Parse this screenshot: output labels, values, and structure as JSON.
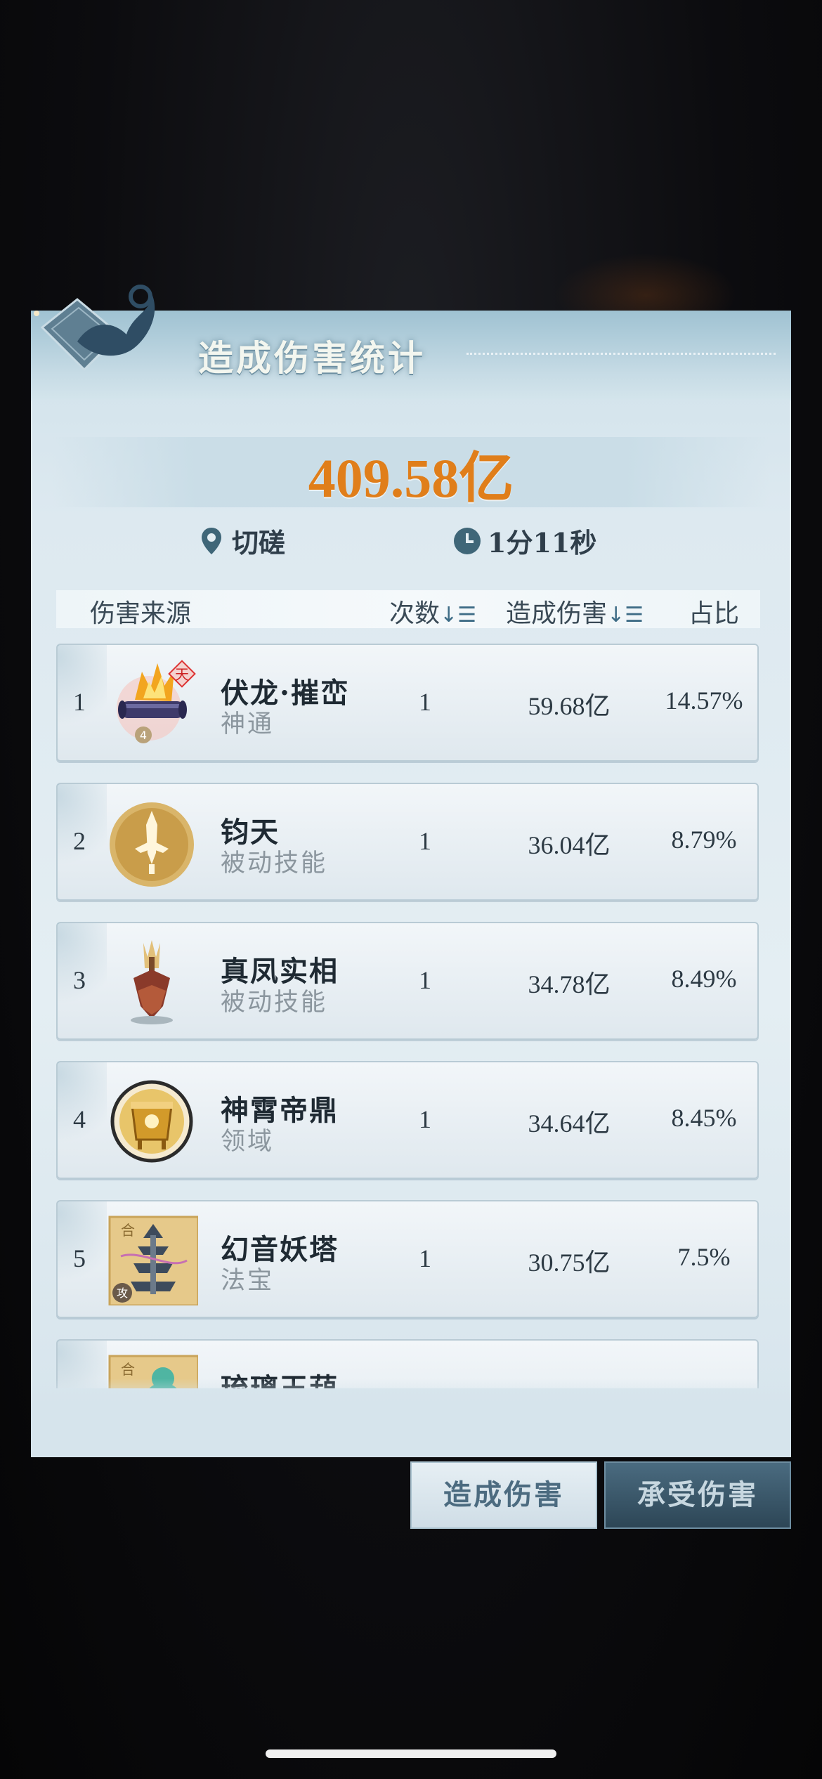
{
  "panel": {
    "title": "造成伤害统计",
    "total_damage": "409.58亿",
    "location": "切磋",
    "duration": "1分11秒"
  },
  "columns": {
    "source": "伤害来源",
    "count": "次数",
    "damage": "造成伤害",
    "ratio": "占比"
  },
  "rows": [
    {
      "rank": "1",
      "name": "伏龙·摧峦",
      "type": "神通",
      "count": "1",
      "damage": "59.68亿",
      "ratio": "14.57%",
      "icon": "fire-scroll-icon",
      "badge": "天",
      "level": "4"
    },
    {
      "rank": "2",
      "name": "钧天",
      "type": "被动技能",
      "count": "1",
      "damage": "36.04亿",
      "ratio": "8.79%",
      "icon": "golden-sword-icon"
    },
    {
      "rank": "3",
      "name": "真凤实相",
      "type": "被动技能",
      "count": "1",
      "damage": "34.78亿",
      "ratio": "8.49%",
      "icon": "phoenix-totem-icon"
    },
    {
      "rank": "4",
      "name": "神霄帝鼎",
      "type": "领域",
      "count": "1",
      "damage": "34.64亿",
      "ratio": "8.45%",
      "icon": "golden-cauldron-icon"
    },
    {
      "rank": "5",
      "name": "幻音妖塔",
      "type": "法宝",
      "count": "1",
      "damage": "30.75亿",
      "ratio": "7.5%",
      "icon": "pagoda-icon",
      "corner_top": "合",
      "corner_bottom": "攻"
    },
    {
      "rank": "",
      "name": "琉璃玉葫",
      "icon": "gourd-icon",
      "corner_top": "合"
    }
  ],
  "tabs": {
    "deal": "造成伤害",
    "take": "承受伤害"
  },
  "colors": {
    "total": "#e07e1a",
    "panel_bg": "#e4eef3",
    "tab_active_bg": "#cfdde6",
    "tab_inactive_bg": "#2d4656"
  }
}
